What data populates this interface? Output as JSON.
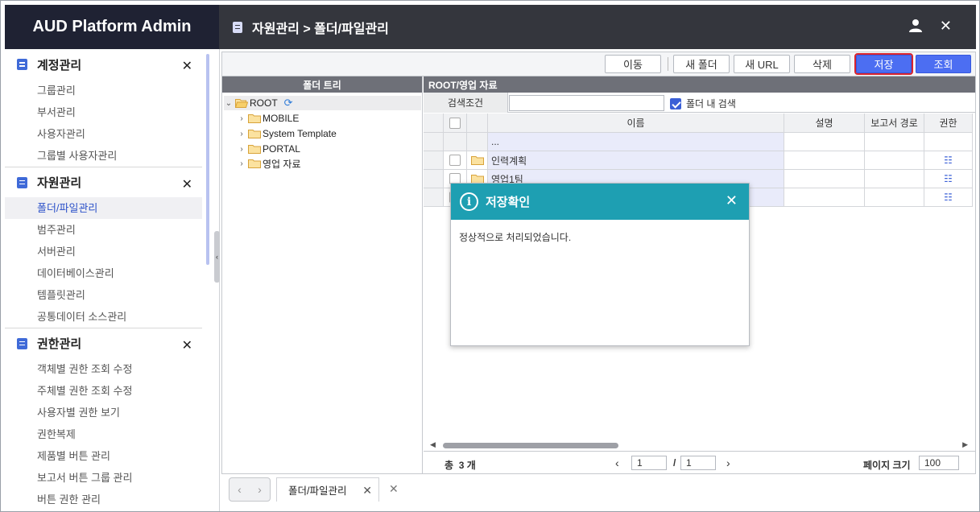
{
  "app": {
    "title": "AUD Platform Admin"
  },
  "header": {
    "breadcrumb": "자원관리 > 폴더/파일관리"
  },
  "sidebar": {
    "groups": [
      {
        "title": "계정관리",
        "items": [
          "그룹관리",
          "부서관리",
          "사용자관리",
          "그룹별 사용자관리"
        ]
      },
      {
        "title": "자원관리",
        "items": [
          "폴더/파일관리",
          "범주관리",
          "서버관리",
          "데이터베이스관리",
          "템플릿관리",
          "공통데이터 소스관리"
        ],
        "active": "폴더/파일관리"
      },
      {
        "title": "권한관리",
        "items": [
          "객체별 권한 조회 수정",
          "주체별 권한 조회 수정",
          "사용자별 권한 보기",
          "권한복제",
          "제품별 버튼 관리",
          "보고서 버튼 그룹 관리",
          "버튼 권한 관리"
        ]
      }
    ]
  },
  "toolbar": {
    "move": "이동",
    "new_folder": "새 폴더",
    "new_url": "새 URL",
    "delete": "삭제",
    "save": "저장",
    "search": "조회"
  },
  "tree": {
    "header": "폴더 트리",
    "root": "ROOT",
    "children": [
      "MOBILE",
      "System Template",
      "PORTAL",
      "영업 자료"
    ]
  },
  "panel": {
    "header": "ROOT/영업 자료",
    "search_label": "검색조건",
    "search_value": "",
    "in_folder_label": "폴더 내 검색",
    "in_folder_checked": true
  },
  "grid": {
    "columns": [
      "이름",
      "설명",
      "보고서 경로",
      "권한"
    ],
    "rows": [
      {
        "name": "...",
        "type": "parent"
      },
      {
        "name": "인력계획",
        "type": "folder"
      },
      {
        "name": "영업1팀",
        "type": "folder"
      },
      {
        "name": "",
        "type": "folder"
      }
    ]
  },
  "pager": {
    "total_label": "총",
    "total_count": "3",
    "total_unit": "개",
    "page": "1",
    "pages": "1",
    "page_size_label": "페이지 크기",
    "page_size": "100"
  },
  "dialog": {
    "title": "저장확인",
    "message": "정상적으로 처리되었습니다."
  },
  "tabs": {
    "open": [
      "폴더/파일관리"
    ]
  },
  "colors": {
    "brand_bg": "#1f2233",
    "header_bg": "#34363d",
    "accent_blue": "#4c6ef2",
    "dialog_head": "#1e9fb2",
    "highlight_red": "#d9232e"
  }
}
